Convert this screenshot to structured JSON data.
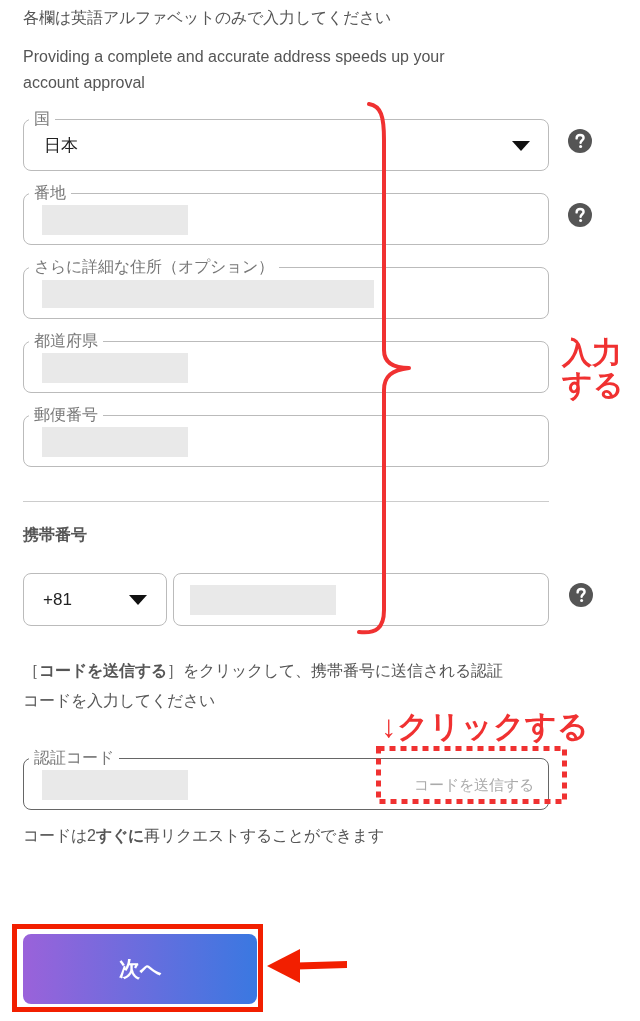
{
  "notes": {
    "alphabet_only": "各欄は英語アルファベットのみで入力してください",
    "address_tip": "Providing a complete and accurate address speeds up your account approval"
  },
  "address_fields": [
    {
      "label": "国",
      "kind": "select",
      "value": "日本",
      "help": true
    },
    {
      "label": "番地",
      "kind": "masked",
      "help": true
    },
    {
      "label": "さらに詳細な住所（オプション）",
      "kind": "masked_wide",
      "help": false
    },
    {
      "label": "都道府県",
      "kind": "masked",
      "help": false
    },
    {
      "label": "郵便番号",
      "kind": "masked",
      "help": false
    }
  ],
  "phone": {
    "heading": "携帯番号",
    "country_code": "+81",
    "masked": true,
    "help": true
  },
  "verification": {
    "instruction": "［**コードを送信する**］をクリックして、携帯番号に送信される認証コードを入力してください",
    "label": "認証コード",
    "masked": true,
    "focused": true,
    "send_code": "コードを送信する",
    "resend_note": "コードは2**すぐに**再リクエストすることができます"
  },
  "next_button": "次へ",
  "annotations": [
    {
      "kind": "brace",
      "text": "入力する"
    },
    {
      "kind": "dotted_box",
      "text": "↓クリックする"
    },
    {
      "kind": "frame_arrow"
    }
  ]
}
